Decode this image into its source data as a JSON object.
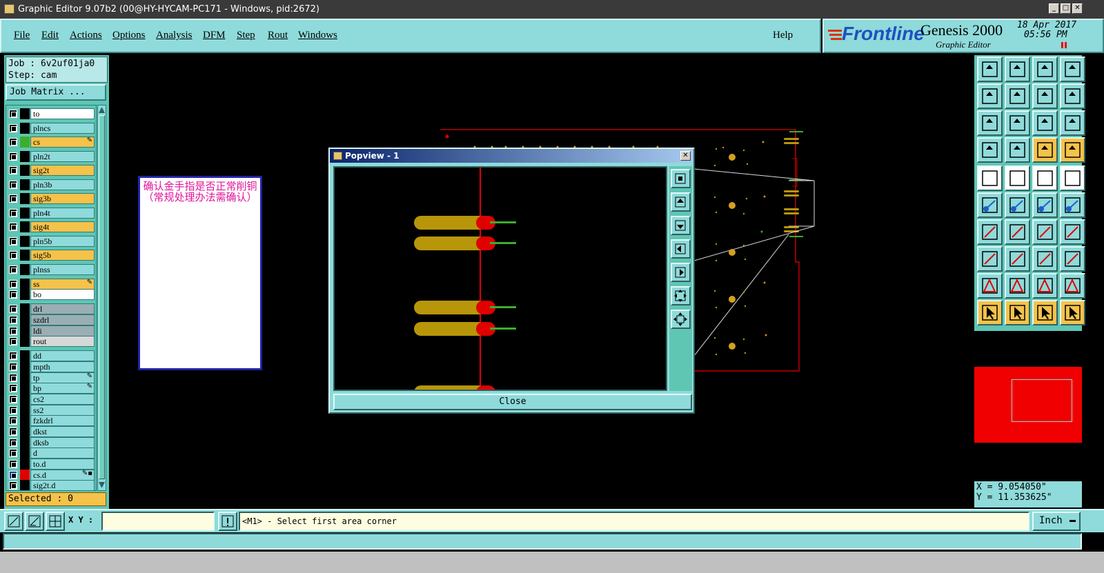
{
  "window": {
    "title": "Graphic Editor 9.07b2 (00@HY-HYCAM-PC171 - Windows, pid:2672)"
  },
  "menu": {
    "items": [
      "File",
      "Edit",
      "Actions",
      "Options",
      "Analysis",
      "DFM",
      "Step",
      "Rout",
      "Windows"
    ],
    "help": "Help"
  },
  "brand": {
    "logo": "Frontline",
    "product": "Genesis 2000",
    "subtitle": "Graphic Editor",
    "date": "18 Apr 2017",
    "time": "05:56 PM"
  },
  "job": {
    "line1": "Job : 6v2uf01ja0",
    "line2": "Step: cam",
    "matrix_button": "Job Matrix ..."
  },
  "layers": [
    {
      "name": "to",
      "color": "#ffffff",
      "swatch": "#000000",
      "mark": ""
    },
    {
      "name": "plncs",
      "color": "#8fdada",
      "swatch": "#000000",
      "mark": ""
    },
    {
      "name": "cs",
      "color": "#f5c24a",
      "swatch": "#3cae2e",
      "mark": "✎"
    },
    {
      "name": "pln2t",
      "color": "#8fdada",
      "swatch": "#000000",
      "mark": ""
    },
    {
      "name": "sig2t",
      "color": "#f5c24a",
      "swatch": "#000000",
      "mark": ""
    },
    {
      "name": "pln3b",
      "color": "#8fdada",
      "swatch": "#000000",
      "mark": ""
    },
    {
      "name": "sig3b",
      "color": "#f5c24a",
      "swatch": "#000000",
      "mark": ""
    },
    {
      "name": "pln4t",
      "color": "#8fdada",
      "swatch": "#000000",
      "mark": ""
    },
    {
      "name": "sig4t",
      "color": "#f5c24a",
      "swatch": "#000000",
      "mark": ""
    },
    {
      "name": "pln5b",
      "color": "#8fdada",
      "swatch": "#000000",
      "mark": ""
    },
    {
      "name": "sig5b",
      "color": "#f5c24a",
      "swatch": "#000000",
      "mark": ""
    },
    {
      "name": "plnss",
      "color": "#8fdada",
      "swatch": "#000000",
      "mark": ""
    },
    {
      "name": "ss",
      "color": "#f5c24a",
      "swatch": "#000000",
      "mark": "✎"
    },
    {
      "name": "bo",
      "color": "#ffffff",
      "swatch": "#000000",
      "mark": ""
    },
    {
      "name": "drl",
      "color": "#9aaeb4",
      "swatch": "#000000",
      "mark": ""
    },
    {
      "name": "szdrl",
      "color": "#9aaeb4",
      "swatch": "#000000",
      "mark": ""
    },
    {
      "name": "ldi",
      "color": "#9aaeb4",
      "swatch": "#000000",
      "mark": ""
    },
    {
      "name": "rout",
      "color": "#d8d8d8",
      "swatch": "#000000",
      "mark": ""
    },
    {
      "name": "dd",
      "color": "#8fdada",
      "swatch": "#000000",
      "mark": ""
    },
    {
      "name": "mpth",
      "color": "#8fdada",
      "swatch": "#000000",
      "mark": ""
    },
    {
      "name": "tp",
      "color": "#8fdada",
      "swatch": "#000000",
      "mark": "✎"
    },
    {
      "name": "bp",
      "color": "#8fdada",
      "swatch": "#000000",
      "mark": "✎"
    },
    {
      "name": "cs2",
      "color": "#8fdada",
      "swatch": "#000000",
      "mark": ""
    },
    {
      "name": "ss2",
      "color": "#8fdada",
      "swatch": "#000000",
      "mark": ""
    },
    {
      "name": "fzkdrl",
      "color": "#8fdada",
      "swatch": "#000000",
      "mark": ""
    },
    {
      "name": "dkst",
      "color": "#8fdada",
      "swatch": "#000000",
      "mark": ""
    },
    {
      "name": "dksb",
      "color": "#8fdada",
      "swatch": "#000000",
      "mark": ""
    },
    {
      "name": "d",
      "color": "#8fdada",
      "swatch": "#000000",
      "mark": ""
    },
    {
      "name": "to.d",
      "color": "#8fdada",
      "swatch": "#000000",
      "mark": ""
    },
    {
      "name": "cs.d",
      "color": "#8fdada",
      "swatch": "#e00000",
      "mark": "✎▪"
    },
    {
      "name": "sig2t.d",
      "color": "#8fdada",
      "swatch": "#000000",
      "mark": ""
    }
  ],
  "selected": "Selected : 0",
  "note": {
    "text": "确认金手指是否正常削铜（常规处理办法需确认）"
  },
  "popview": {
    "title": "Popview - 1",
    "close_label": "Close"
  },
  "coords": {
    "x": "X = 9.054050\"",
    "y": "Y = 11.353625\""
  },
  "bottom": {
    "xy_label": "X Y :",
    "prompt": "<M1> - Select first area corner",
    "units": "Inch"
  },
  "colors": {
    "panel": "#8fdada",
    "accent": "#f5c24a",
    "board": "#e00000"
  }
}
